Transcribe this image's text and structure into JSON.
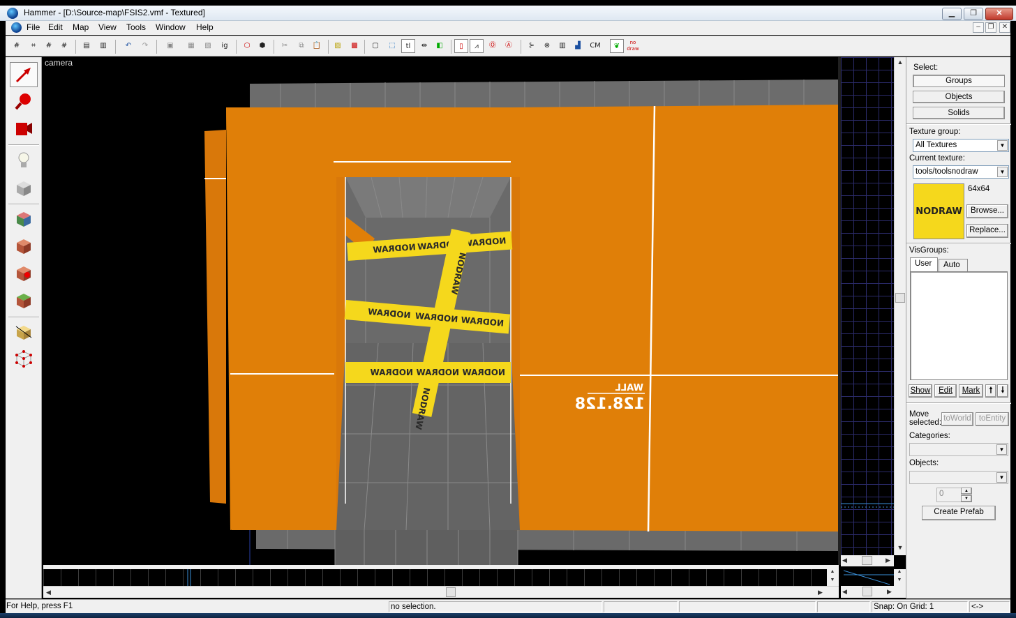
{
  "window": {
    "title": "Hammer - [D:\\Source-map\\FSIS2.vmf - Textured]",
    "minimize": "▁",
    "restore": "❐",
    "close": "✕"
  },
  "menu": {
    "items": [
      "File",
      "Edit",
      "Map",
      "View",
      "Tools",
      "Window",
      "Help"
    ],
    "mdi_minimize": "–",
    "mdi_restore": "❐",
    "mdi_close": "✕"
  },
  "toolbar": {
    "ignore_groups_label": "ig",
    "texture_lock_label": "tl",
    "cordon_label": "CM",
    "nodraw_label": "no draw"
  },
  "tools": [
    {
      "name": "selection-tool",
      "icon": "arrow-icon"
    },
    {
      "name": "magnify-tool",
      "icon": "magnifier-icon"
    },
    {
      "name": "camera-tool",
      "icon": "camera-icon"
    },
    {
      "name": "entity-tool",
      "icon": "lightbulb-icon"
    },
    {
      "name": "block-tool",
      "icon": "cube-icon"
    },
    {
      "name": "texture-application-tool",
      "icon": "textured-cube-icon"
    },
    {
      "name": "apply-current-texture-tool",
      "icon": "brick-cube-icon"
    },
    {
      "name": "decal-tool",
      "icon": "decal-cube-icon"
    },
    {
      "name": "overlay-tool",
      "icon": "overlay-cube-icon"
    },
    {
      "name": "clipping-tool",
      "icon": "clip-icon"
    },
    {
      "name": "vertex-tool",
      "icon": "vertex-icon"
    }
  ],
  "viewport": {
    "camera_label": "camera",
    "wall_overlay_label": "WALL",
    "wall_overlay_size": "128.128",
    "nodraw_text": "NODRAW"
  },
  "panel": {
    "select_label": "Select:",
    "groups_button": "Groups",
    "objects_button": "Objects",
    "solids_button": "Solids",
    "texture_group_label": "Texture group:",
    "texture_group_value": "All Textures",
    "current_texture_label": "Current texture:",
    "current_texture_value": "tools/toolsnodraw",
    "texture_size": "64x64",
    "texture_preview_text": "NODRAW",
    "browse_button": "Browse...",
    "replace_button": "Replace...",
    "visgroups_label": "VisGroups:",
    "tab_user": "User",
    "tab_auto": "Auto",
    "show_button": "Show",
    "edit_button": "Edit",
    "mark_button": "Mark",
    "up_button": "🠕",
    "down_button": "🠗",
    "move_selected_label_1": "Move",
    "move_selected_label_2": "selected:",
    "to_world_button": "toWorld",
    "to_entity_button": "toEntity",
    "categories_label": "Categories:",
    "objects_label": "Objects:",
    "spinner_value": "0",
    "create_prefab_button": "Create Prefab"
  },
  "status": {
    "help_text": "For Help, press F1",
    "selection_text": "no selection.",
    "snap_text": "Snap: On Grid: 1",
    "arrows_text": "<->"
  },
  "colors": {
    "wall_orange": "#e07f08",
    "floor_gray": "#6a6a6a",
    "nodraw_yellow": "#f5d81c"
  }
}
